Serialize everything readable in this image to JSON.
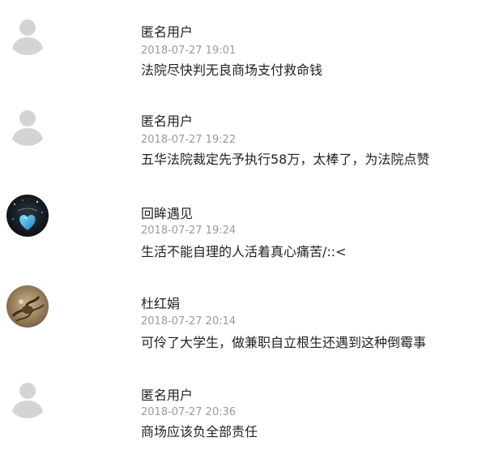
{
  "colors": {
    "username": "#222222",
    "timestamp": "#9a9a9a",
    "body_text": "#222222",
    "default_avatar": "#d4d4d4"
  },
  "comments": [
    {
      "avatar": "default-user-icon",
      "user": "匿名用户",
      "time": "2018-07-27 19:01",
      "text": "法院尽快判无良商场支付救命钱"
    },
    {
      "avatar": "default-user-icon",
      "user": "匿名用户",
      "time": "2018-07-27 19:22",
      "text": "五华法院裁定先予执行58万，太棒了，为法院点赞"
    },
    {
      "avatar": "blue-heart-photo-avatar",
      "user": "回眸遇见",
      "time": "2018-07-27 19:24",
      "text": "生活不能自理的人活着真心痛苦/::<"
    },
    {
      "avatar": "sepia-photo-avatar",
      "user": "杜红娟",
      "time": "2018-07-27 20:14",
      "text": "可伶了大学生，做兼职自立根生还遇到这种倒霉事"
    },
    {
      "avatar": "default-user-icon",
      "user": "匿名用户",
      "time": "2018-07-27 20:36",
      "text": "商场应该负全部责任"
    }
  ]
}
